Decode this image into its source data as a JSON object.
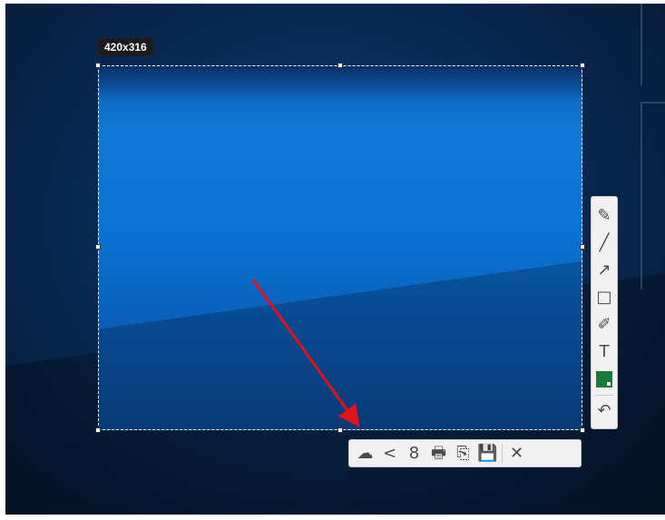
{
  "selection": {
    "size_label": "420x316"
  },
  "annotation": {
    "arrow_color": "#e0131a"
  },
  "draw_toolbar": {
    "tools": [
      {
        "name": "pen-icon",
        "glyph": "✎"
      },
      {
        "name": "line-icon",
        "glyph": "╱"
      },
      {
        "name": "arrow-icon",
        "glyph": "↗"
      },
      {
        "name": "rectangle-icon",
        "glyph": "□"
      },
      {
        "name": "marker-icon",
        "glyph": "✐"
      },
      {
        "name": "text-icon",
        "glyph": "T"
      }
    ],
    "color": "#1a7a37",
    "undo_glyph": "↶"
  },
  "action_toolbar": {
    "actions": [
      {
        "name": "upload-cloud-icon",
        "glyph": "☁"
      },
      {
        "name": "share-icon",
        "glyph": "<"
      },
      {
        "name": "google-search-icon",
        "glyph": "8"
      },
      {
        "name": "print-icon",
        "glyph": "🖶"
      },
      {
        "name": "copy-icon",
        "glyph": "⎘"
      },
      {
        "name": "save-icon",
        "glyph": "💾"
      }
    ],
    "close_glyph": "✕"
  }
}
